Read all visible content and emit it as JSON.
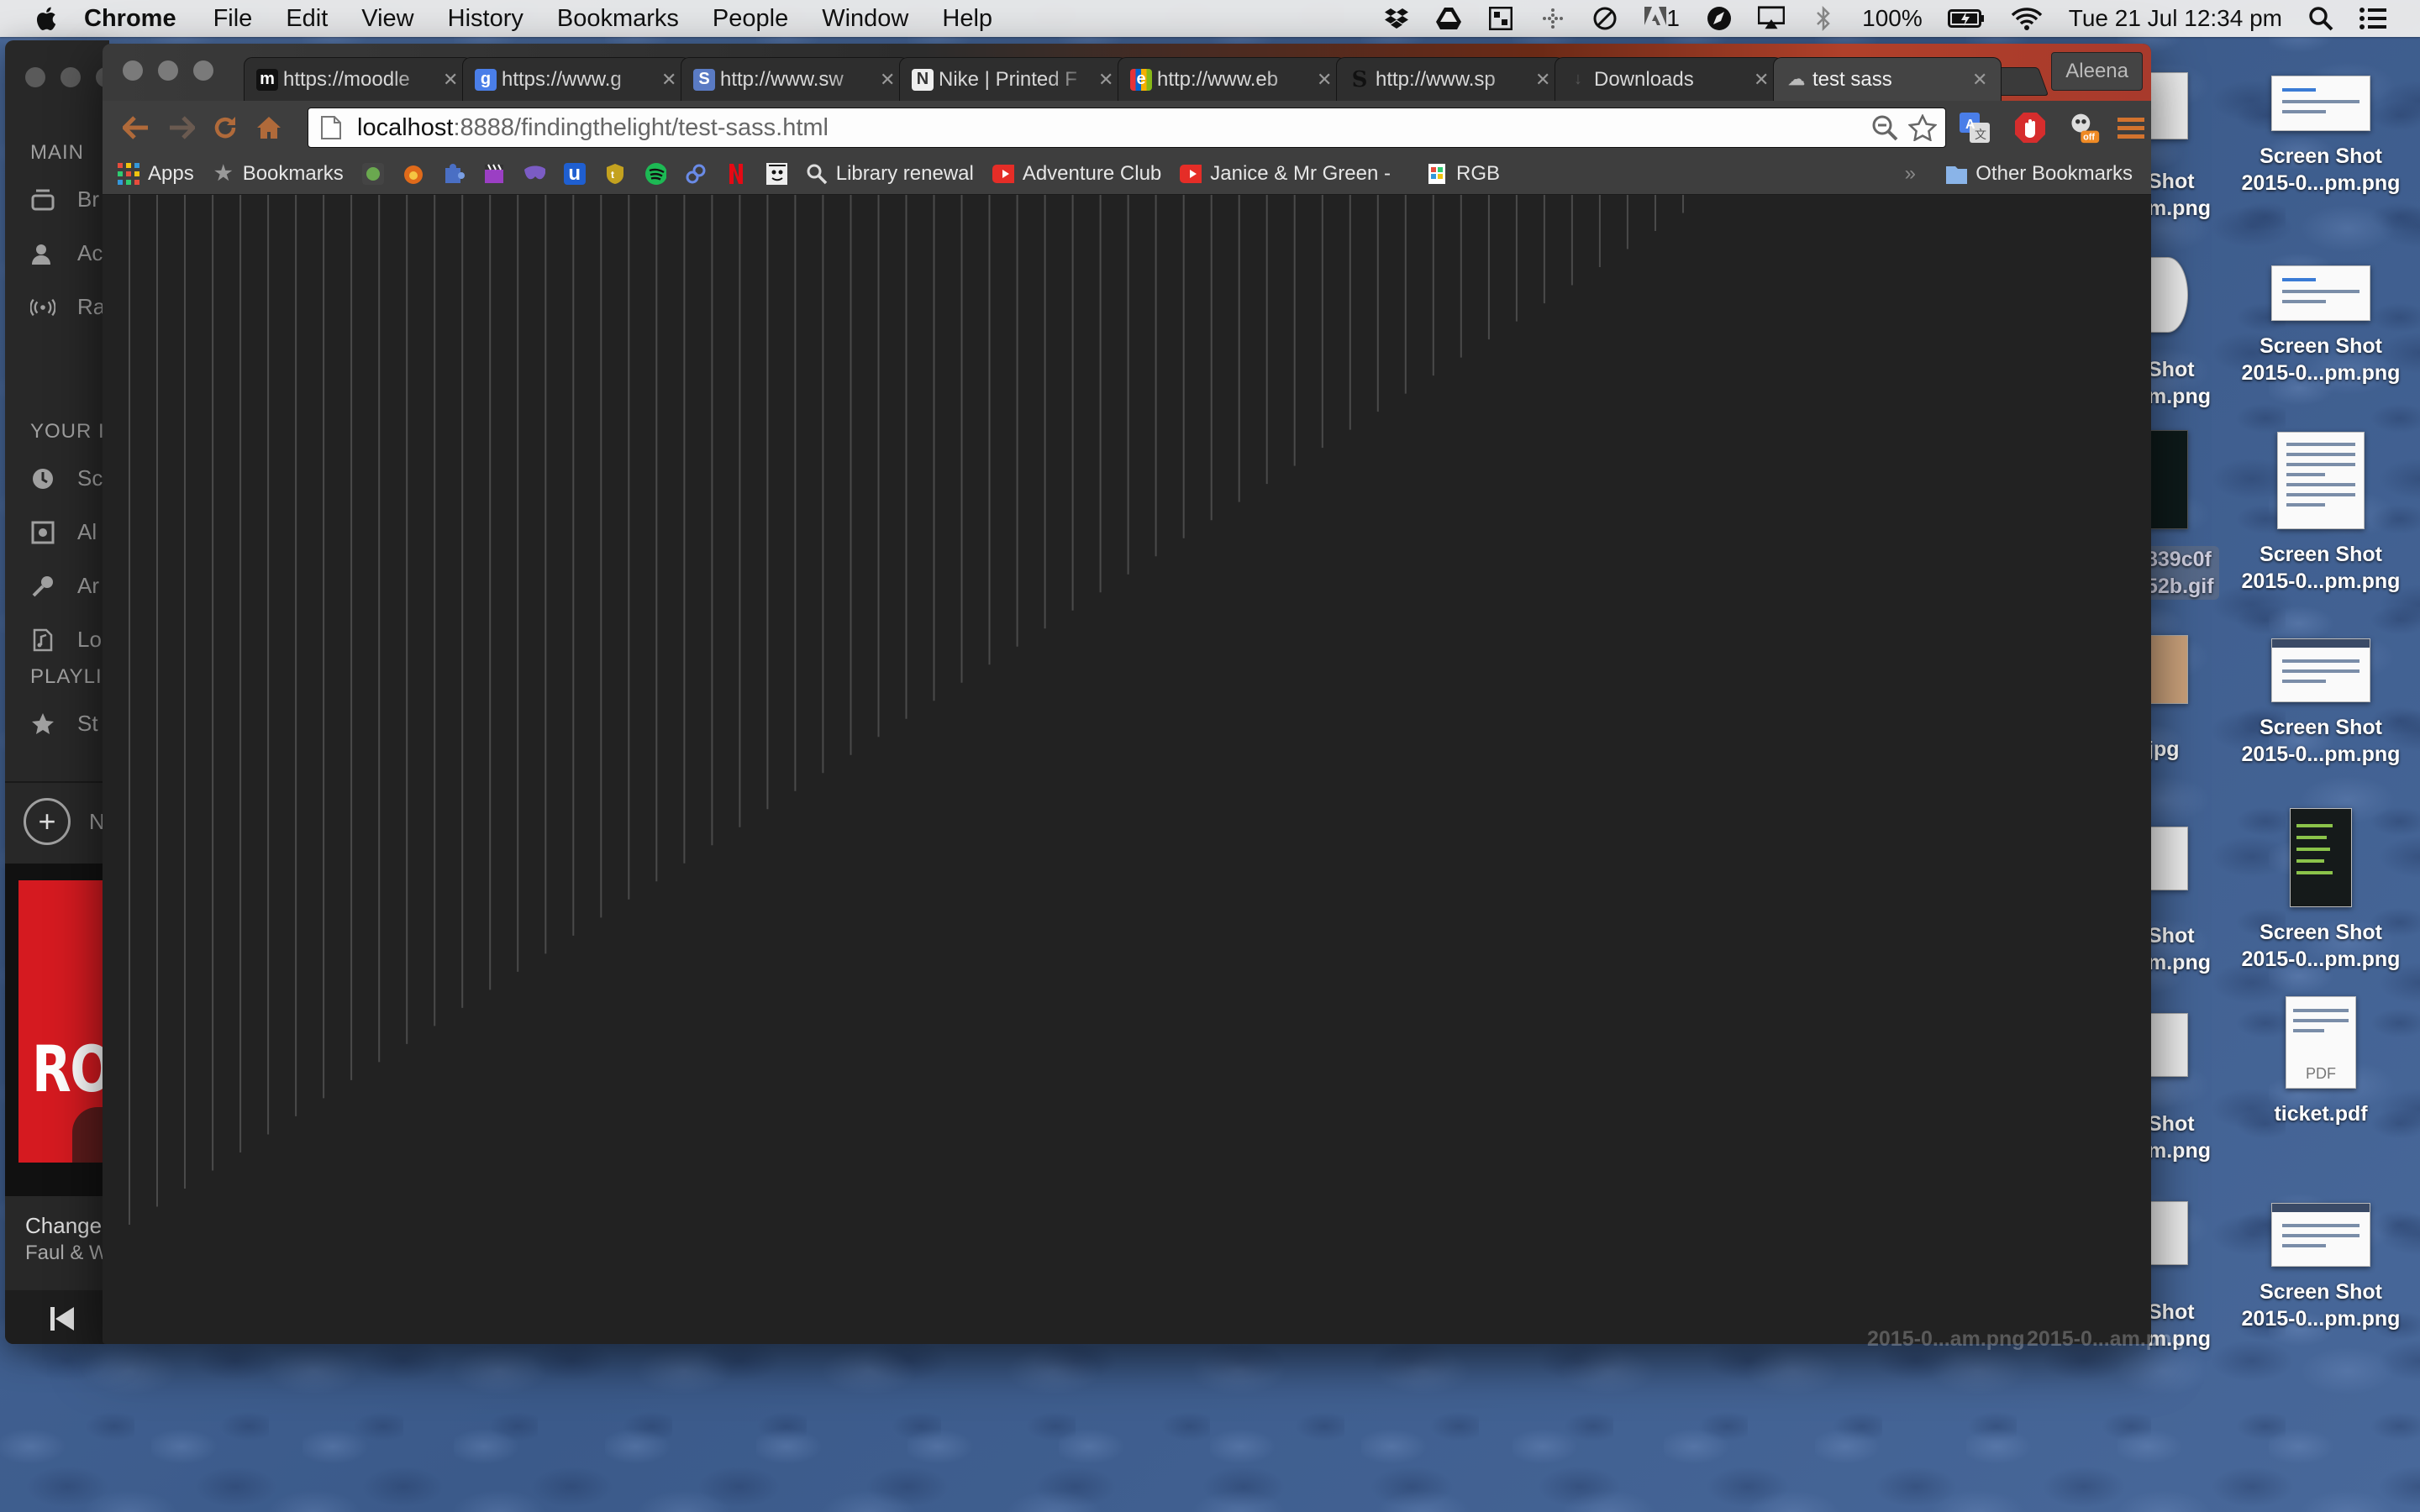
{
  "menubar": {
    "app_name": "Chrome",
    "items": [
      "File",
      "Edit",
      "View",
      "History",
      "Bookmarks",
      "People",
      "Window",
      "Help"
    ],
    "battery": "100%",
    "datetime": "Tue 21 Jul  12:34 pm",
    "status_icons": [
      "dropbox-icon",
      "google-drive-icon",
      "grid-icon",
      "dotted-grid-icon",
      "no-entry-icon",
      "adobe-icon",
      "compass-icon",
      "airplay-icon",
      "bluetooth-icon",
      "battery-icon",
      "wifi-icon",
      "spotlight-icon",
      "notification-center-icon"
    ],
    "adobe_count": "1"
  },
  "spotify": {
    "sections": {
      "main": "MAIN",
      "your": "YOUR I",
      "playlists": "PLAYLI"
    },
    "main_items": [
      {
        "label": "Br",
        "icon": "radio-browse-icon"
      },
      {
        "label": "Ac",
        "icon": "activity-icon"
      },
      {
        "label": "Ra",
        "icon": "radio-waves-icon"
      }
    ],
    "your_items": [
      {
        "label": "Sc",
        "icon": "clock-icon"
      },
      {
        "label": "Al",
        "icon": "album-icon"
      },
      {
        "label": "Ar",
        "icon": "microphone-icon"
      },
      {
        "label": "Lo",
        "icon": "music-file-icon"
      }
    ],
    "playlist_items": [
      {
        "label": "St",
        "icon": "star-icon"
      }
    ],
    "new_playlist": "N",
    "album_word": "ROB",
    "song_title": "Change",
    "artist": "Faul & W"
  },
  "chrome": {
    "profile": "Aleena",
    "tabs": [
      {
        "title": "https://moodle",
        "favicon": "m",
        "favicon_color": "#111111",
        "active": false
      },
      {
        "title": "https://www.g",
        "favicon": "g",
        "favicon_color": "#4a7ee8",
        "active": false
      },
      {
        "title": "http://www.sw",
        "favicon": "S",
        "favicon_color": "#5a7bc4",
        "active": false
      },
      {
        "title": "Nike | Printed F",
        "favicon": "N",
        "favicon_color": "#ffffff",
        "active": false
      },
      {
        "title": "http://www.eb",
        "favicon": "e",
        "favicon_color": "#e53238",
        "active": false
      },
      {
        "title": "http://www.sp",
        "favicon": "S",
        "favicon_color": "#111111",
        "active": false
      },
      {
        "title": "Downloads",
        "favicon": "↓",
        "favicon_color": "#555555",
        "active": false
      },
      {
        "title": "test sass",
        "favicon": "☁",
        "favicon_color": "#777777",
        "active": true
      }
    ],
    "url": {
      "host": "localhost",
      "path": ":8888/findingthelight/test-sass.html"
    },
    "bookmarks": {
      "apps": "Apps",
      "bookmarks": "Bookmarks",
      "icon_items": [
        {
          "icon": "green-dot-icon",
          "color": "#6aa84f"
        },
        {
          "icon": "fox-icon",
          "color": "#e06a1a"
        },
        {
          "icon": "puzzle-icon",
          "color": "#4a6fc4"
        },
        {
          "icon": "clapper-icon",
          "color": "#9b3fc4"
        },
        {
          "icon": "mask-icon",
          "color": "#7b5cc4"
        },
        {
          "icon": "u-icon",
          "color": "#1f5fd1",
          "text": "u"
        },
        {
          "icon": "badge-icon",
          "color": "#c4a21f"
        },
        {
          "icon": "spotify-icon",
          "color": "#1db954"
        },
        {
          "icon": "link-icon",
          "color": "#2a5bd7"
        },
        {
          "icon": "netflix-icon",
          "color": "#e50914"
        },
        {
          "icon": "face-icon",
          "color": "#dddddd"
        }
      ],
      "library": "Library renewal",
      "adventure": "Adventure Club",
      "janice": "Janice & Mr Green -",
      "rgb": "RGB",
      "other": "Other Bookmarks"
    },
    "content_bg": "#222222",
    "line_color": "#4a4a4a"
  },
  "desktop": {
    "files": [
      {
        "label1": "Screen Shot",
        "label2": "2015-0...pm.png"
      },
      {
        "label1": "Screen Shot",
        "label2": "2015-0...pm.png"
      },
      {
        "label1": "Screen Shot",
        "label2": "2015-0...pm.png"
      },
      {
        "label1": "Screen Shot",
        "label2": "2015-0...pm.png"
      },
      {
        "label1": "Screen Shot",
        "label2": "2015-0...pm.png"
      },
      {
        "label1": "ticket.pdf",
        "label2": ""
      },
      {
        "label1": "Screen Shot",
        "label2": "2015-0...pm.png"
      }
    ],
    "partial_labels": [
      {
        "l1": "Shot",
        "l2": "m.png"
      },
      {
        "l1": "Shot",
        "l2": "m.png"
      },
      {
        "l1": "839c0f",
        "l2": "52b.gif"
      },
      {
        "l1": "jpg",
        "l2": ""
      },
      {
        "l1": "Shot",
        "l2": "m.png"
      },
      {
        "l1": "Shot",
        "l2": "m.png"
      },
      {
        "l1": "Shot",
        "l2": "m.png"
      }
    ],
    "pdf_tag": "PDF"
  }
}
